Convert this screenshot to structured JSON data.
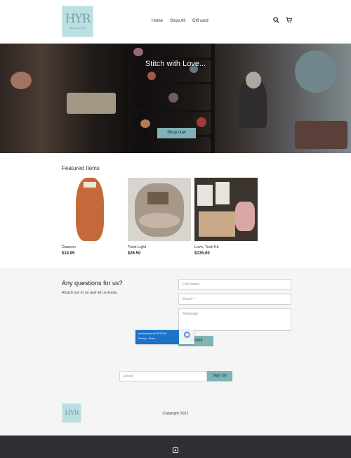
{
  "brand": {
    "logo_text": "HYR",
    "logo_sub": "Handy Yarn Room"
  },
  "nav": {
    "items": [
      "Home",
      "Shop All",
      "Gift card"
    ]
  },
  "icons": {
    "search": "search-icon",
    "cart": "cart-icon",
    "footer": "square-logo-icon"
  },
  "hero": {
    "title": "Stitch with Love...",
    "cta": "Shop now"
  },
  "featured": {
    "title": "Featured Items",
    "products": [
      {
        "name": "Dawson",
        "price": "$14.95"
      },
      {
        "name": "Twist Light",
        "price": "$26.50"
      },
      {
        "name": "Love, Tosh Kit",
        "price": "$135.00"
      }
    ]
  },
  "contact": {
    "title": "Any questions for us?",
    "subtitle": "Reach out to us and let us know.",
    "fullname_placeholder": "Full name",
    "email_placeholder": "Email *",
    "message_placeholder": "Message",
    "submit_label": "Submit",
    "recaptcha_text": "protected by reCAPTCHA",
    "recaptcha_links": "Privacy - Terms"
  },
  "newsletter": {
    "email_placeholder": "Email",
    "button_label": "Sign Up"
  },
  "footer": {
    "copyright": "Copyright 2021"
  },
  "colors": {
    "accent": "#7fb3b6",
    "logo_bg": "#b9e1e4",
    "footer_bg": "#2e2f33"
  }
}
